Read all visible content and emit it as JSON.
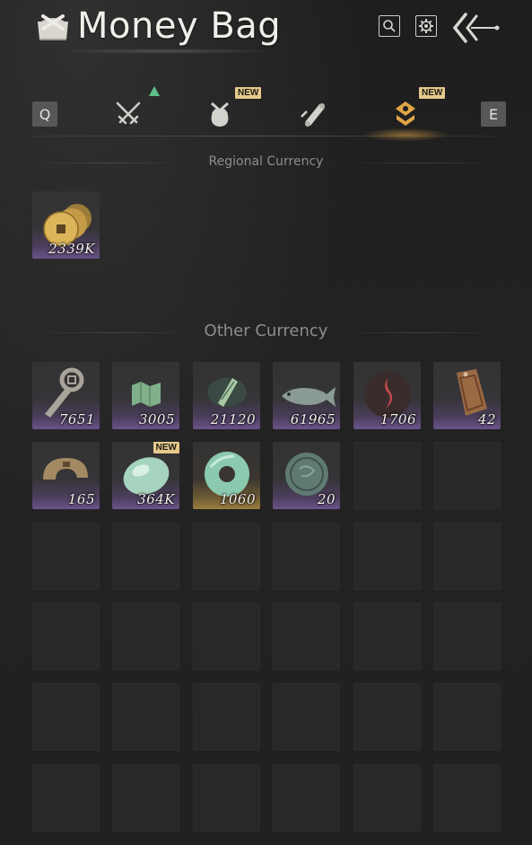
{
  "header": {
    "title": "Money Bag",
    "search_icon": "search-icon",
    "settings_icon": "gear-icon",
    "back_icon": "back-arrow-icon"
  },
  "tabs": {
    "left_key": "Q",
    "right_key": "E",
    "items": [
      {
        "icon": "crossed-swords-icon",
        "badge": "",
        "indicator": "up-arrow"
      },
      {
        "icon": "pouch-icon",
        "badge": "NEW"
      },
      {
        "icon": "scroll-icon",
        "badge": ""
      },
      {
        "icon": "currency-icon",
        "badge": "NEW",
        "active": true
      }
    ]
  },
  "regional": {
    "title": "Regional Currency",
    "items": [
      {
        "icon": "coins-icon",
        "qty": "2339K"
      }
    ]
  },
  "other": {
    "title": "Other Currency",
    "items": [
      {
        "icon": "coin-key-icon",
        "qty": "7651"
      },
      {
        "icon": "map-token-icon",
        "qty": "3005"
      },
      {
        "icon": "jade-plaque-icon",
        "qty": "21120"
      },
      {
        "icon": "fish-icon",
        "qty": "61965"
      },
      {
        "icon": "spirit-orb-icon",
        "qty": "1706"
      },
      {
        "icon": "bronze-tablet-icon",
        "qty": "42"
      },
      {
        "icon": "broken-coin-icon",
        "qty": "165"
      },
      {
        "icon": "jade-stone-icon",
        "qty": "364K",
        "badge": "NEW"
      },
      {
        "icon": "jade-ring-icon",
        "qty": "1060"
      },
      {
        "icon": "bronze-disc-icon",
        "qty": "20"
      }
    ]
  },
  "colors": {
    "new_badge": "#e6c98a",
    "active_tab": "#e0a545",
    "rarity_purple": "#6a548a",
    "rarity_gold": "#9a7e3e"
  }
}
